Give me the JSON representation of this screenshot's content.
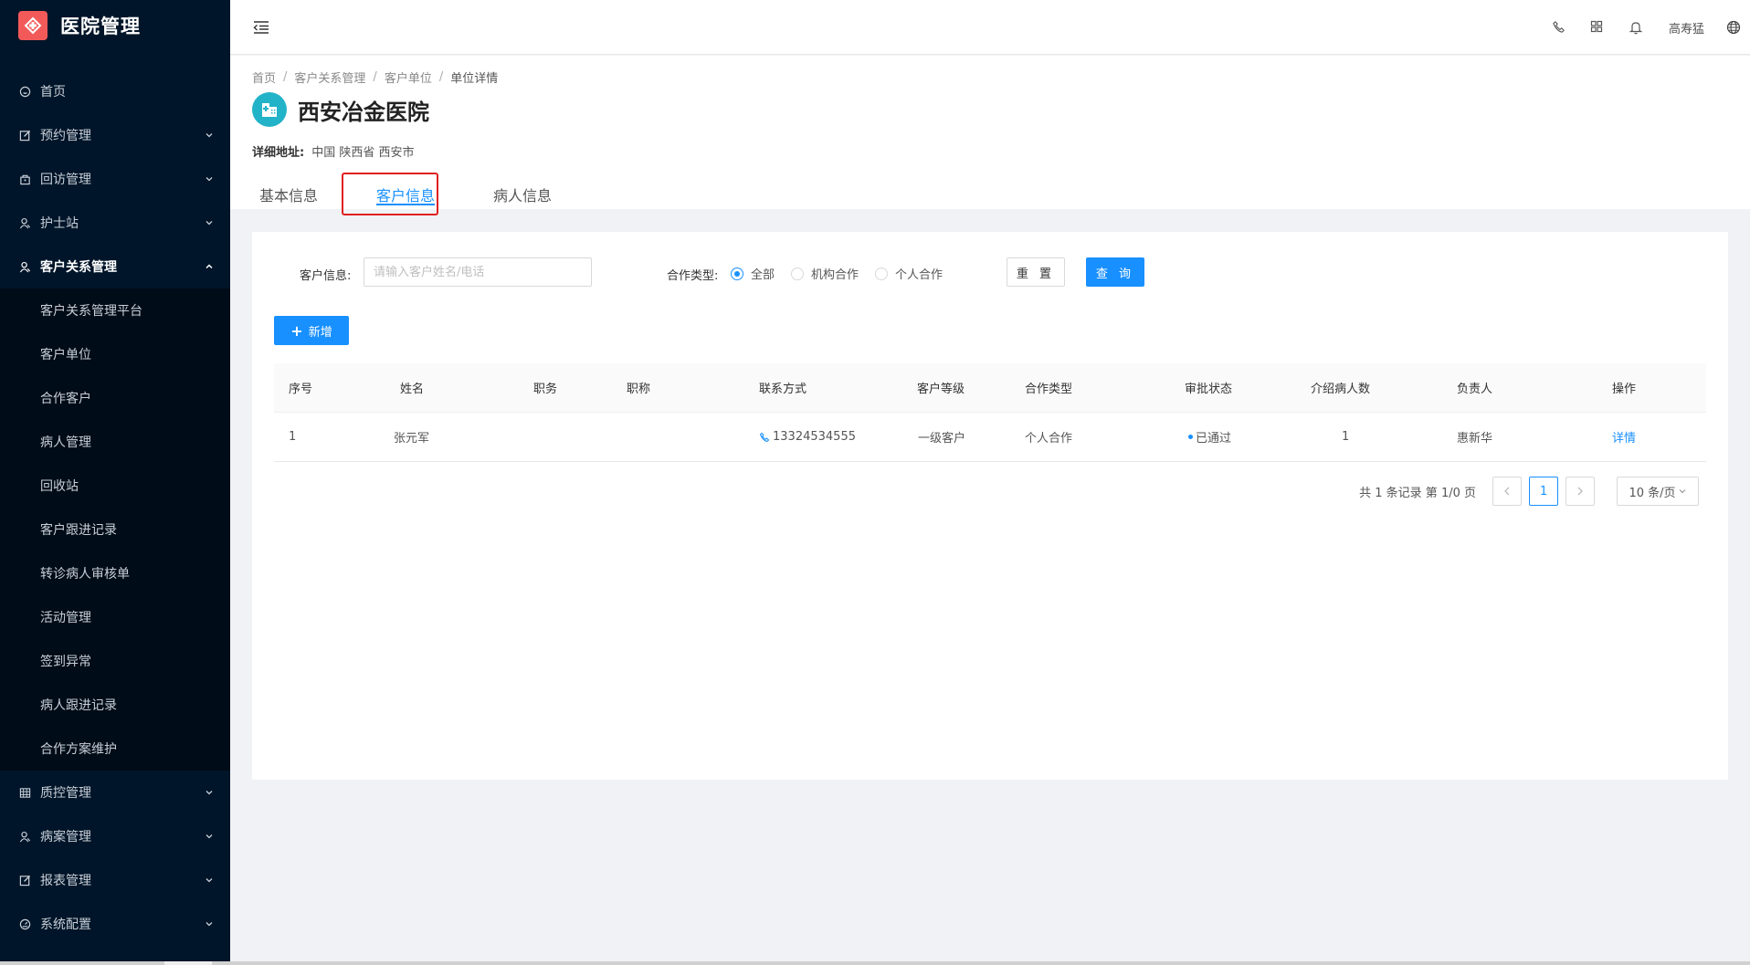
{
  "app": {
    "title": "医院管理"
  },
  "sidebar": {
    "items": [
      {
        "label": "首页",
        "icon": "home-icon"
      },
      {
        "label": "预约管理",
        "icon": "edit-icon"
      },
      {
        "label": "回访管理",
        "icon": "bag-icon"
      },
      {
        "label": "护士站",
        "icon": "user-icon"
      },
      {
        "label": "客户关系管理",
        "icon": "user-icon"
      }
    ],
    "submenu": [
      "客户关系管理平台",
      "客户单位",
      "合作客户",
      "病人管理",
      "回收站",
      "客户跟进记录",
      "转诊病人审核单",
      "活动管理",
      "签到异常",
      "病人跟进记录",
      "合作方案维护"
    ],
    "bottom_items": [
      {
        "label": "质控管理",
        "icon": "table-icon"
      },
      {
        "label": "病案管理",
        "icon": "user-icon"
      },
      {
        "label": "报表管理",
        "icon": "edit-icon"
      },
      {
        "label": "系统配置",
        "icon": "dashboard-icon"
      }
    ]
  },
  "header": {
    "user_name": "高寿猛",
    "icons": [
      "phone-icon",
      "grid-icon",
      "bell-icon",
      "globe-icon"
    ]
  },
  "breadcrumb": [
    "首页",
    "客户关系管理",
    "客户单位",
    "单位详情"
  ],
  "org": {
    "name": "西安冶金医院",
    "address_label": "详细地址:",
    "address_value": "中国 陕西省 西安市"
  },
  "tabs": [
    "基本信息",
    "客户信息",
    "病人信息"
  ],
  "active_tab": "客户信息",
  "filter": {
    "customer_label": "客户信息:",
    "customer_placeholder": "请输入客户姓名/电话",
    "coop_label": "合作类型:",
    "coop_options": [
      "全部",
      "机构合作",
      "个人合作"
    ],
    "coop_selected": "全部",
    "reset_label": "重 置",
    "query_label": "查 询"
  },
  "add_button": "新增",
  "table": {
    "columns": [
      "序号",
      "姓名",
      "职务",
      "职称",
      "联系方式",
      "客户等级",
      "合作类型",
      "审批状态",
      "介绍病人数",
      "负责人",
      "操作"
    ],
    "rows": [
      {
        "index": "1",
        "name": "张元军",
        "position": "",
        "title": "",
        "phone": "13324534555",
        "level": "一级客户",
        "coop_type": "个人合作",
        "status": "已通过",
        "referrals": "1",
        "owner": "惠新华",
        "action": "详情"
      }
    ]
  },
  "pagination": {
    "summary": "共 1 条记录 第 1/0 页",
    "current_page": "1",
    "page_size": "10 条/页"
  },
  "colors": {
    "primary": "#1890ff",
    "sidebar": "#001529",
    "logo": "#f25a5a",
    "highlight": "#e02020"
  }
}
